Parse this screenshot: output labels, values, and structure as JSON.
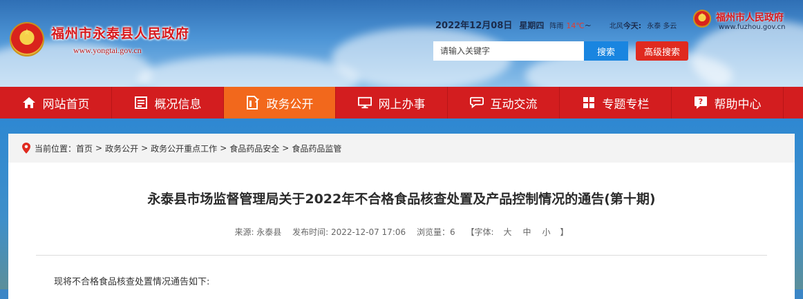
{
  "header": {
    "site_title": "福州市永泰县人民政府",
    "site_domain": "www.yongtai.gov.cn",
    "date": "2022年12月08日",
    "weekday": "星期四",
    "weather_desc": "阵雨",
    "temperature": "14℃",
    "temperature_sep": "~",
    "wind": "北风",
    "today_label": "今天:",
    "city": "永泰 多云",
    "fuzhou_title": "福州市人民政府",
    "fuzhou_domain": "www.fuzhou.gov.cn",
    "search_placeholder": "请输入关键字",
    "search_button": "搜索",
    "advanced_search_button": "高级搜索"
  },
  "nav": {
    "items": [
      {
        "label": "网站首页",
        "icon": "home-icon"
      },
      {
        "label": "概况信息",
        "icon": "list-icon"
      },
      {
        "label": "政务公开",
        "icon": "document-icon",
        "active": true
      },
      {
        "label": "网上办事",
        "icon": "monitor-icon"
      },
      {
        "label": "互动交流",
        "icon": "chat-icon"
      },
      {
        "label": "专题专栏",
        "icon": "grid-icon"
      },
      {
        "label": "帮助中心",
        "icon": "help-icon"
      }
    ]
  },
  "breadcrumb": {
    "label": "当前位置：",
    "items": [
      "首页",
      "政务公开",
      "政务公开重点工作",
      "食品药品安全",
      "食品药品监管"
    ],
    "separator": ">"
  },
  "article": {
    "title": "永泰县市场监督管理局关于2022年不合格食品核查处置及产品控制情况的通告(第十期)",
    "source": "来源: 永泰县",
    "publish_time": "发布时间: 2022-12-07 17:06",
    "views": "浏览量：6",
    "font_size_open": "【字体:",
    "font_large": "大",
    "font_medium": "中",
    "font_small": "小",
    "font_size_close": "】",
    "intro": "现将不合格食品核查处置情况通告如下:"
  },
  "colors": {
    "nav_bg": "#d31d1f",
    "nav_active": "#f2681c",
    "search_button": "#1985e0",
    "advanced_button": "#e02a1f",
    "title_red": "#d8191c"
  }
}
